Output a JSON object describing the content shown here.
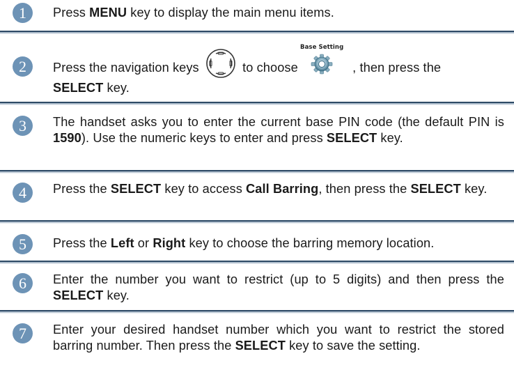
{
  "steps": [
    {
      "number": "1",
      "parts": [
        "Press ",
        "MENU",
        " key to display the main menu items."
      ]
    },
    {
      "number": "2",
      "parts": [
        "Press the navigation keys",
        "to choose",
        ", then press the ",
        "SELECT",
        " key."
      ],
      "icon_label": "Base Setting",
      "nav_icon": "navigation-keys-icon",
      "setting_icon": "base-setting-icon"
    },
    {
      "number": "3",
      "parts": [
        "The handset asks you to enter the current base PIN code (the default PIN is ",
        "1590",
        "). Use the numeric keys to enter and press ",
        "SELECT",
        " key."
      ]
    },
    {
      "number": "4",
      "parts": [
        "Press the ",
        "SELECT",
        " key to access ",
        "Call Barring",
        ", then press the ",
        "SELECT",
        " key."
      ]
    },
    {
      "number": "5",
      "parts": [
        "Press the ",
        "Left",
        " or ",
        "Right",
        " key to choose the barring memory location."
      ]
    },
    {
      "number": "6",
      "parts": [
        "Enter the number you want to restrict (up to 5 digits) and then press the ",
        "SELECT",
        " key."
      ]
    },
    {
      "number": "7",
      "parts": [
        "Enter your desired handset number which you want to restrict the stored barring number. Then press the ",
        "SELECT",
        " key to save the setting."
      ]
    }
  ],
  "colors": {
    "step_circle": "#6d93b6",
    "divider": "#2e4a66"
  }
}
